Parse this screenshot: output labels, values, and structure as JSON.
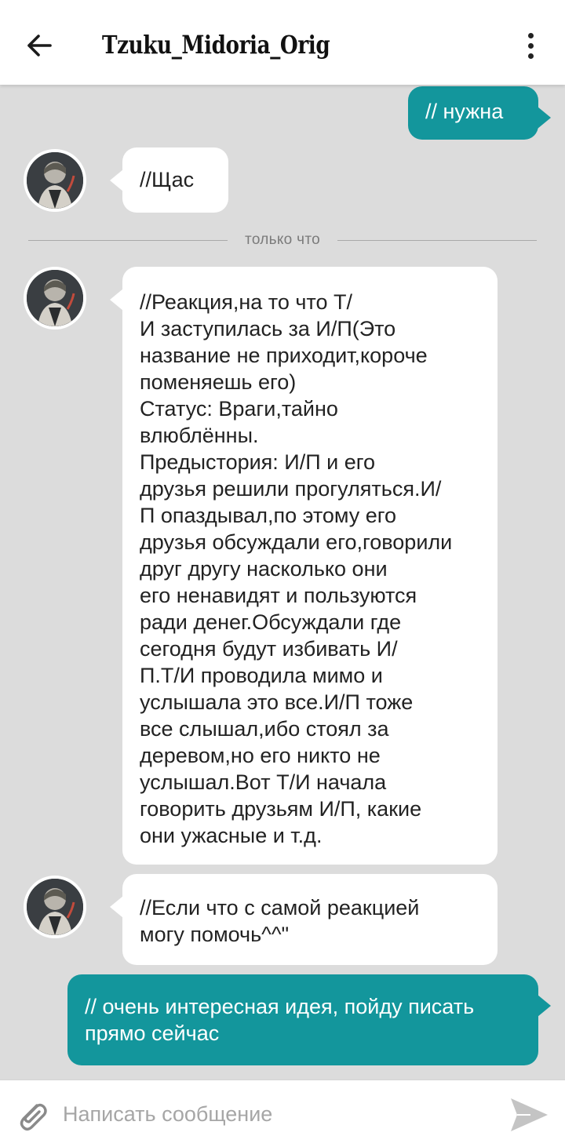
{
  "header": {
    "title": "Tzuku_Midoria_Orig"
  },
  "messages": [
    {
      "direction": "out",
      "text": "// нужна"
    },
    {
      "direction": "in",
      "text": "//Щас"
    },
    {
      "direction": "in",
      "text": "//Реакция,на то что Т/\nИ заступилась за И/П(Это\nназвание не приходит,короче\nпоменяешь его)\nСтатус: Враги,тайно\nвлюблённы.\nПредыстория: И/П и его\nдрузья решили прогуляться.И/\nП опаздывал,по этому его\nдрузья обсуждали его,говорили\nдруг другу насколько они\nего ненавидят и пользуются\nради денег.Обсуждали где\nсегодня будут избивать И/\nП.Т/И проводила мимо и\nуслышала это все.И/П тоже\nвсе слышал,ибо стоял за\nдеревом,но его никто не\nуслышал.Вот Т/И начала\nговорить друзьям И/П, какие\nони ужасные и т.д."
    },
    {
      "direction": "in",
      "text": "//Если что с самой реакцией\nмогу помочь^^\""
    },
    {
      "direction": "out",
      "text": "// очень интересная идея, пойду писать\nпрямо сейчас"
    }
  ],
  "divider": {
    "label": "только что"
  },
  "composer": {
    "placeholder": "Написать сообщение"
  },
  "icons": {
    "back": "arrow-left-icon",
    "menu": "more-vertical-icon",
    "avatar": "avatar",
    "attach": "paperclip-icon",
    "send": "send-icon"
  },
  "colors": {
    "outgoing_bubble": "#13969c",
    "incoming_bubble": "#ffffff",
    "chat_background": "#dcdcdc",
    "header_background": "#ffffff"
  }
}
